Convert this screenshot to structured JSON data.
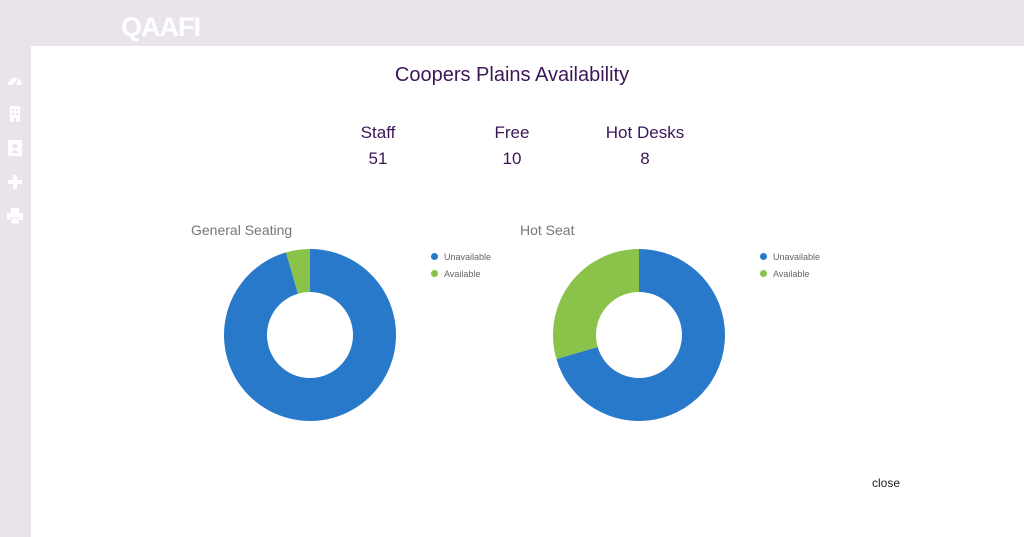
{
  "app": {
    "logo": "QAAFI"
  },
  "sidebar": {
    "icons": [
      "dashboard-icon",
      "building-icon",
      "contact-icon",
      "plus-icon",
      "print-icon"
    ]
  },
  "modal": {
    "title": "Coopers Plains Availability",
    "stats": [
      {
        "label": "Staff",
        "value": "51"
      },
      {
        "label": "Free",
        "value": "10"
      },
      {
        "label": "Hot Desks",
        "value": "8"
      }
    ],
    "close_label": "close"
  },
  "colors": {
    "unavailable": "#2979cb",
    "available": "#8bc34a",
    "title": "#3c1756"
  },
  "chart_data": [
    {
      "type": "pie",
      "title": "General Seating",
      "categories": [
        "Unavailable",
        "Available"
      ],
      "values": [
        95.5,
        4.5
      ],
      "legend": "right"
    },
    {
      "type": "pie",
      "title": "Hot Seat",
      "categories": [
        "Unavailable",
        "Available"
      ],
      "values": [
        70.5,
        29.5
      ],
      "legend": "right"
    }
  ]
}
